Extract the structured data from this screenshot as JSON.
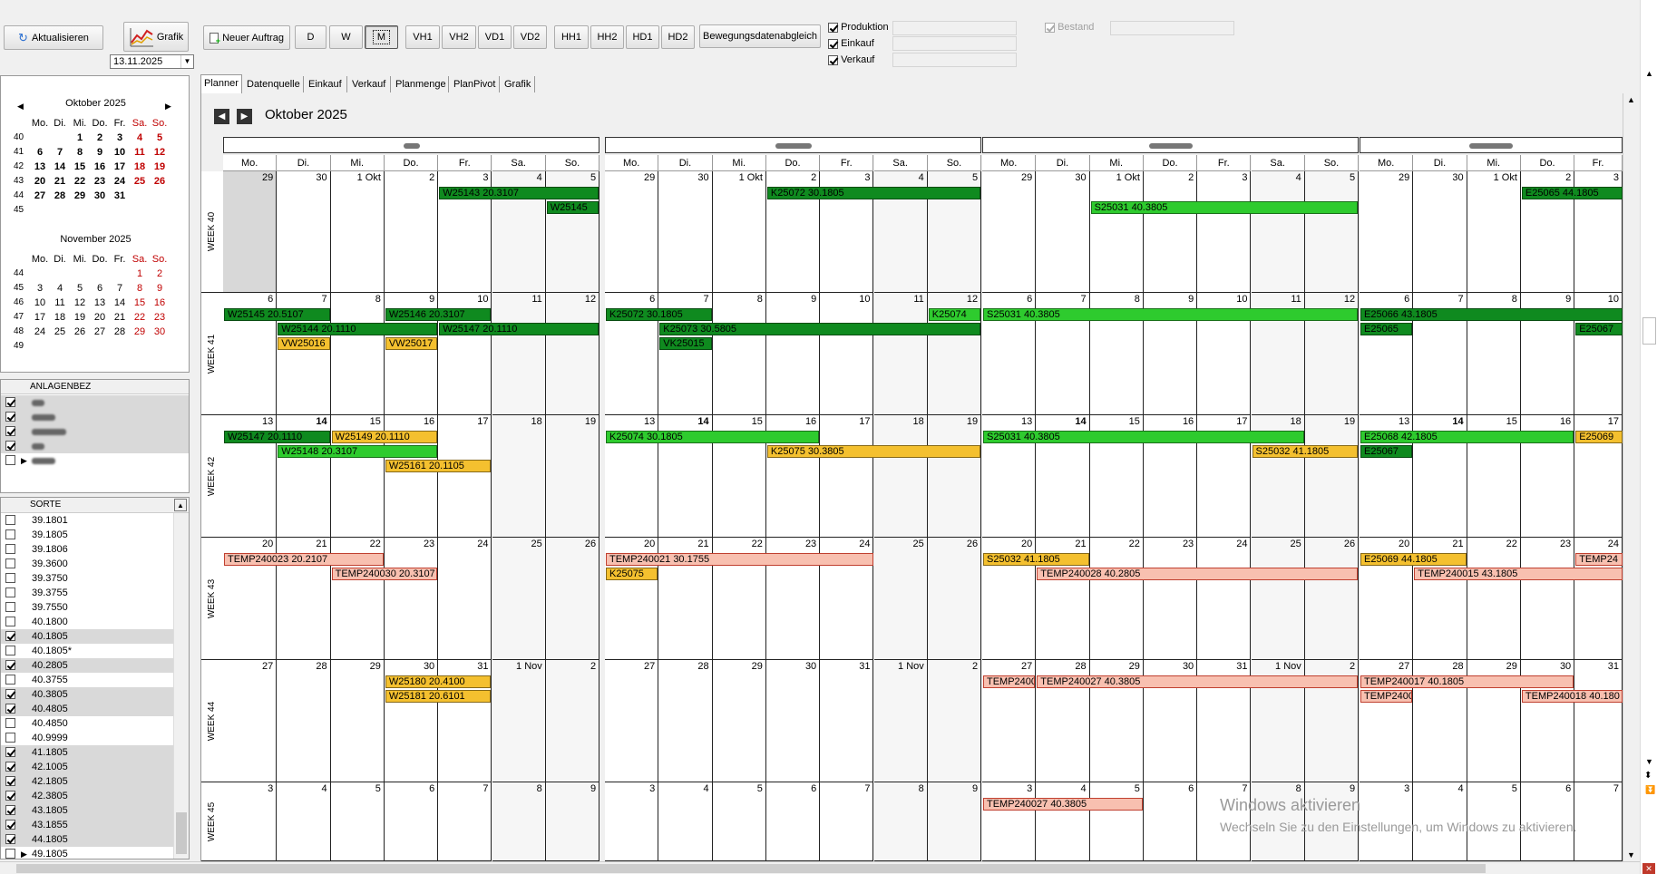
{
  "toolbar": {
    "refresh": "Aktualisieren",
    "chart": "Grafik",
    "new_order": "Neuer Auftrag",
    "view_d": "D",
    "view_w": "W",
    "view_m": "M",
    "vh1": "VH1",
    "vh2": "VH2",
    "vd1": "VD1",
    "vd2": "VD2",
    "hh1": "HH1",
    "hh2": "HH2",
    "hd1": "HD1",
    "hd2": "HD2",
    "motion_sync": "Bewegungsdatenabgleich",
    "date": "13.11.2025",
    "cb_production": "Produktion",
    "cb_purchase": "Einkauf",
    "cb_sales": "Verkauf",
    "cb_stock": "Bestand"
  },
  "mini_cal": {
    "weekdays": [
      "Mo.",
      "Di.",
      "Mi.",
      "Do.",
      "Fr.",
      "Sa.",
      "So."
    ],
    "oct_title": "Oktober 2025",
    "nov_title": "November 2025",
    "oct_weeks": [
      "40",
      "41",
      "42",
      "43",
      "44",
      "45"
    ],
    "nov_weeks": [
      "44",
      "45",
      "46",
      "47",
      "48",
      "49"
    ],
    "oct_rows": [
      [
        "",
        "",
        "1",
        "2",
        "3",
        "4",
        "5"
      ],
      [
        "6",
        "7",
        "8",
        "9",
        "10",
        "11",
        "12"
      ],
      [
        "13",
        "14",
        "15",
        "16",
        "17",
        "18",
        "19"
      ],
      [
        "20",
        "21",
        "22",
        "23",
        "24",
        "25",
        "26"
      ],
      [
        "27",
        "28",
        "29",
        "30",
        "31",
        "",
        ""
      ],
      [
        "",
        "",
        "",
        "",
        "",
        "",
        ""
      ]
    ],
    "nov_rows": [
      [
        "",
        "",
        "",
        "",
        "",
        "1",
        "2"
      ],
      [
        "3",
        "4",
        "5",
        "6",
        "7",
        "8",
        "9"
      ],
      [
        "10",
        "11",
        "12",
        "13",
        "14",
        "15",
        "16"
      ],
      [
        "17",
        "18",
        "19",
        "20",
        "21",
        "22",
        "23"
      ],
      [
        "24",
        "25",
        "26",
        "27",
        "28",
        "29",
        "30"
      ],
      [
        "",
        "",
        "",
        "",
        "",
        "",
        ""
      ]
    ]
  },
  "plants": {
    "header": "ANLAGENBEZ",
    "items": [
      {
        "checked": true
      },
      {
        "checked": true
      },
      {
        "checked": true
      },
      {
        "checked": true
      },
      {
        "checked": false
      }
    ]
  },
  "sorts": {
    "header": "SORTE",
    "items": [
      {
        "label": "39.1801",
        "checked": false
      },
      {
        "label": "39.1805",
        "checked": false
      },
      {
        "label": "39.1806",
        "checked": false
      },
      {
        "label": "39.3600",
        "checked": false
      },
      {
        "label": "39.3750",
        "checked": false
      },
      {
        "label": "39.3755",
        "checked": false
      },
      {
        "label": "39.7550",
        "checked": false
      },
      {
        "label": "40.1800",
        "checked": false
      },
      {
        "label": "40.1805",
        "checked": true
      },
      {
        "label": "40.1805*",
        "checked": false
      },
      {
        "label": "40.2805",
        "checked": true
      },
      {
        "label": "40.3755",
        "checked": false
      },
      {
        "label": "40.3805",
        "checked": true
      },
      {
        "label": "40.4805",
        "checked": true
      },
      {
        "label": "40.4850",
        "checked": false
      },
      {
        "label": "40.9999",
        "checked": false
      },
      {
        "label": "41.1805",
        "checked": true
      },
      {
        "label": "42.1005",
        "checked": true
      },
      {
        "label": "42.1805",
        "checked": true
      },
      {
        "label": "42.3805",
        "checked": true
      },
      {
        "label": "43.1805",
        "checked": true
      },
      {
        "label": "43.1855",
        "checked": true
      },
      {
        "label": "44.1805",
        "checked": true
      },
      {
        "label": "49.1805",
        "checked": false
      }
    ]
  },
  "tabs": [
    "Planner",
    "Datenquelle",
    "Einkauf",
    "Verkauf",
    "Planmenge",
    "PlanPivot",
    "Grafik"
  ],
  "planner": {
    "title": "Oktober 2025",
    "weekdays": [
      "Mo.",
      "Di.",
      "Mi.",
      "Do.",
      "Fr.",
      "Sa.",
      "So."
    ],
    "week_labels": [
      "WEEK 40",
      "WEEK 41",
      "WEEK 42",
      "WEEK 43",
      "WEEK 44",
      "WEEK 45"
    ],
    "day_rows": [
      [
        "29",
        "30",
        "1 Okt",
        "2",
        "3",
        "4",
        "5"
      ],
      [
        "6",
        "7",
        "8",
        "9",
        "10",
        "11",
        "12"
      ],
      [
        "13",
        "14",
        "15",
        "16",
        "17",
        "18",
        "19"
      ],
      [
        "20",
        "21",
        "22",
        "23",
        "24",
        "25",
        "26"
      ],
      [
        "27",
        "28",
        "29",
        "30",
        "31",
        "1 Nov",
        "2"
      ],
      [
        "3",
        "4",
        "5",
        "6",
        "7",
        "8",
        "9"
      ]
    ],
    "events": [
      {
        "g": 0,
        "w": 0,
        "d": 4,
        "len": 3,
        "lane": 0,
        "c": "dg",
        "t": "W25143 20.3107"
      },
      {
        "g": 0,
        "w": 0,
        "d": 6,
        "len": 1,
        "lane": 1,
        "c": "dg",
        "t": "W25145"
      },
      {
        "g": 0,
        "w": 1,
        "d": 0,
        "len": 2,
        "lane": 0,
        "c": "dg",
        "t": "W25145 20.5107"
      },
      {
        "g": 0,
        "w": 1,
        "d": 3,
        "len": 2,
        "lane": 0,
        "c": "dg",
        "t": "W25146 20.3107"
      },
      {
        "g": 0,
        "w": 1,
        "d": 1,
        "len": 3,
        "lane": 1,
        "c": "dg",
        "t": "W25144 20.1110"
      },
      {
        "g": 0,
        "w": 1,
        "d": 4,
        "len": 3,
        "lane": 1,
        "c": "dg",
        "t": "W25147 20.1110"
      },
      {
        "g": 0,
        "w": 1,
        "d": 1,
        "len": 1,
        "lane": 2,
        "c": "or",
        "t": "VW25016"
      },
      {
        "g": 0,
        "w": 1,
        "d": 3,
        "len": 1,
        "lane": 2,
        "c": "or",
        "t": "VW25017"
      },
      {
        "g": 0,
        "w": 2,
        "d": 0,
        "len": 2,
        "lane": 0,
        "c": "dg",
        "t": "W25147 20.1110"
      },
      {
        "g": 0,
        "w": 2,
        "d": 2,
        "len": 2,
        "lane": 0,
        "c": "or",
        "t": "W25149 20.1110"
      },
      {
        "g": 0,
        "w": 2,
        "d": 1,
        "len": 3,
        "lane": 1,
        "c": "lg",
        "t": "W25148 20.3107"
      },
      {
        "g": 0,
        "w": 2,
        "d": 3,
        "len": 2,
        "lane": 2,
        "c": "or",
        "t": "W25161 20.1105"
      },
      {
        "g": 0,
        "w": 3,
        "d": 0,
        "len": 3,
        "lane": 0,
        "c": "pk",
        "t": "TEMP240023 20.2107"
      },
      {
        "g": 0,
        "w": 3,
        "d": 2,
        "len": 2,
        "lane": 1,
        "c": "pk",
        "t": "TEMP240030 20.3107"
      },
      {
        "g": 0,
        "w": 4,
        "d": 3,
        "len": 2,
        "lane": 0,
        "c": "or",
        "t": "W25180 20.4100"
      },
      {
        "g": 0,
        "w": 4,
        "d": 3,
        "len": 2,
        "lane": 1,
        "c": "or",
        "t": "W25181 20.6101"
      },
      {
        "g": 1,
        "w": 0,
        "d": 3,
        "len": 4,
        "lane": 0,
        "c": "dg",
        "t": "K25072 30.1805"
      },
      {
        "g": 1,
        "w": 1,
        "d": 0,
        "len": 2,
        "lane": 0,
        "c": "dg",
        "t": "K25072 30.1805"
      },
      {
        "g": 1,
        "w": 1,
        "d": 6,
        "len": 1,
        "lane": 0,
        "c": "lg",
        "t": "K25074"
      },
      {
        "g": 1,
        "w": 1,
        "d": 1,
        "len": 6,
        "lane": 1,
        "c": "dg",
        "t": "K25073 30.5805"
      },
      {
        "g": 1,
        "w": 1,
        "d": 1,
        "len": 1,
        "lane": 2,
        "c": "dg",
        "t": "VK25015"
      },
      {
        "g": 1,
        "w": 2,
        "d": 0,
        "len": 4,
        "lane": 0,
        "c": "lg",
        "t": "K25074 30.1805"
      },
      {
        "g": 1,
        "w": 2,
        "d": 3,
        "len": 4,
        "lane": 1,
        "c": "or",
        "t": "K25075 30.3805"
      },
      {
        "g": 1,
        "w": 3,
        "d": 0,
        "len": 5,
        "lane": 0,
        "c": "pk",
        "t": "TEMP240021 30.1755"
      },
      {
        "g": 1,
        "w": 3,
        "d": 0,
        "len": 1,
        "lane": 1,
        "c": "or",
        "t": "K25075"
      },
      {
        "g": 2,
        "w": 0,
        "d": 2,
        "len": 5,
        "lane": 1,
        "c": "lg",
        "t": "S25031 40.3805"
      },
      {
        "g": 2,
        "w": 1,
        "d": 0,
        "len": 7,
        "lane": 0,
        "c": "lg",
        "t": "S25031 40.3805"
      },
      {
        "g": 2,
        "w": 2,
        "d": 0,
        "len": 6,
        "lane": 0,
        "c": "lg",
        "t": "S25031 40.3805"
      },
      {
        "g": 2,
        "w": 2,
        "d": 5,
        "len": 2,
        "lane": 1,
        "c": "or",
        "t": "S25032 41.1805"
      },
      {
        "g": 2,
        "w": 3,
        "d": 0,
        "len": 2,
        "lane": 0,
        "c": "or",
        "t": "S25032 41.1805"
      },
      {
        "g": 2,
        "w": 3,
        "d": 1,
        "len": 6,
        "lane": 1,
        "c": "pk",
        "t": "TEMP240028 40.2805"
      },
      {
        "g": 2,
        "w": 4,
        "d": 0,
        "len": 1,
        "lane": 0,
        "c": "pk",
        "t": "TEMP2400"
      },
      {
        "g": 2,
        "w": 4,
        "d": 1,
        "len": 6,
        "lane": 0,
        "c": "pk",
        "t": "TEMP240027 40.3805"
      },
      {
        "g": 2,
        "w": 5,
        "d": 0,
        "len": 3,
        "lane": 0,
        "c": "pk",
        "t": "TEMP240027 40.3805"
      },
      {
        "g": 3,
        "w": 0,
        "d": 3,
        "len": 2,
        "lane": 0,
        "c": "dg",
        "t": "E25065 44.1805"
      },
      {
        "g": 3,
        "w": 1,
        "d": 0,
        "len": 5,
        "lane": 0,
        "c": "dg",
        "t": "E25066 43.1805"
      },
      {
        "g": 3,
        "w": 1,
        "d": 0,
        "len": 1,
        "lane": 1,
        "c": "dg",
        "t": "E25065"
      },
      {
        "g": 3,
        "w": 1,
        "d": 4,
        "len": 1,
        "lane": 1,
        "c": "dg",
        "t": "E25067"
      },
      {
        "g": 3,
        "w": 2,
        "d": 0,
        "len": 4,
        "lane": 0,
        "c": "lg",
        "t": "E25068 42.1805"
      },
      {
        "g": 3,
        "w": 2,
        "d": 4,
        "len": 1,
        "lane": 0,
        "c": "or",
        "t": "E25069"
      },
      {
        "g": 3,
        "w": 2,
        "d": 0,
        "len": 1,
        "lane": 1,
        "c": "dg",
        "t": "E25067"
      },
      {
        "g": 3,
        "w": 3,
        "d": 0,
        "len": 2,
        "lane": 0,
        "c": "or",
        "t": "E25069 44.1805"
      },
      {
        "g": 3,
        "w": 3,
        "d": 4,
        "len": 1,
        "lane": 0,
        "c": "pk",
        "t": "TEMP24"
      },
      {
        "g": 3,
        "w": 3,
        "d": 1,
        "len": 4,
        "lane": 1,
        "c": "pk",
        "t": "TEMP240015 43.1805"
      },
      {
        "g": 3,
        "w": 4,
        "d": 0,
        "len": 4,
        "lane": 0,
        "c": "pk",
        "t": "TEMP240017 40.1805"
      },
      {
        "g": 3,
        "w": 4,
        "d": 0,
        "len": 1,
        "lane": 1,
        "c": "pk",
        "t": "TEMP2400"
      },
      {
        "g": 3,
        "w": 4,
        "d": 3,
        "len": 2,
        "lane": 1,
        "c": "pk",
        "t": "TEMP240018 40.180"
      }
    ]
  },
  "watermark": {
    "title": "Windows aktivieren",
    "subtitle": "Wechseln Sie zu den Einstellungen, um Windows zu aktivieren."
  },
  "colors": {
    "dark_green": "#0f8a1f",
    "light_green": "#2ecb2e",
    "orange": "#f4c02f",
    "pink": "#f8c0b0",
    "weekend_red": "#c00000"
  }
}
